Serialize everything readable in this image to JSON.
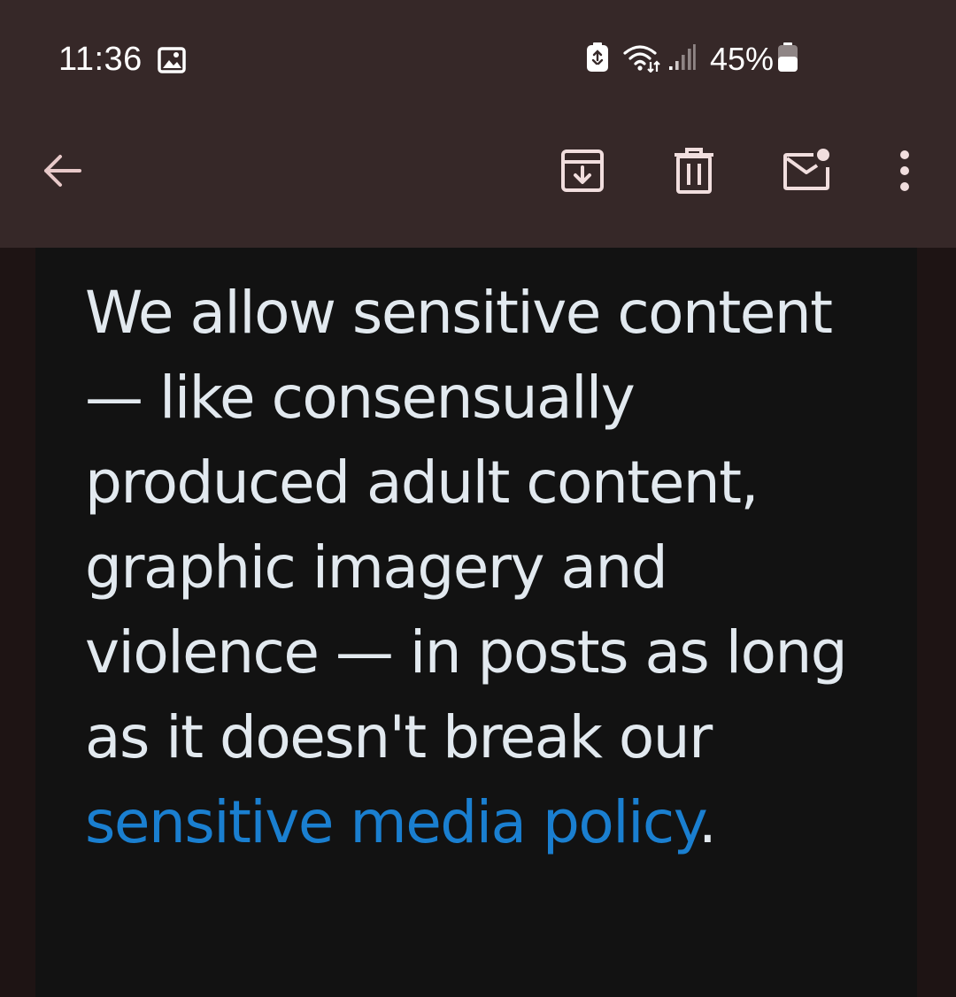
{
  "status_bar": {
    "time": "11:36",
    "battery_text": "45%",
    "icons": [
      "gallery-icon",
      "battery-saver-icon",
      "wifi-icon",
      "signal-icon",
      "battery-icon"
    ]
  },
  "toolbar": {
    "icons": [
      "back-arrow-icon",
      "archive-icon",
      "delete-icon",
      "mark-unread-icon",
      "more-vert-icon"
    ]
  },
  "message": {
    "body_before_link": "We allow sensitive content — like consensually produced adult content, graphic imagery and violence — in posts as long as it doesn't break our ",
    "link_text": "sensitive media policy",
    "body_after_link": "."
  },
  "colors": {
    "bar_background": "#362828",
    "content_background": "#121212",
    "page_background": "#1e1414",
    "text": "#e2e9ef",
    "link": "#1a7fd0"
  }
}
